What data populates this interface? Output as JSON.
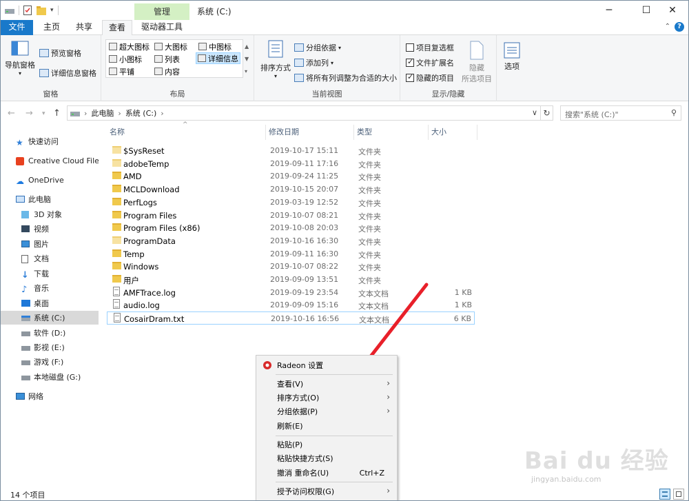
{
  "title": {
    "context_tab": "管理",
    "window_title": "系统 (C:)"
  },
  "tabs": [
    "文件",
    "主页",
    "共享",
    "查看",
    "驱动器工具"
  ],
  "ribbon": {
    "panes": {
      "nav_pane": "导航窗格",
      "preview_pane": "预览窗格",
      "details_pane": "详细信息窗格",
      "group_label": "窗格"
    },
    "layout": {
      "items": [
        "超大图标",
        "大图标",
        "中图标",
        "小图标",
        "列表",
        "详细信息",
        "平铺",
        "内容"
      ],
      "selected": "详细信息",
      "group_label": "布局"
    },
    "current_view": {
      "sort_by": "排序方式",
      "group_by": "分组依据",
      "add_columns": "添加列",
      "size_all_columns": "将所有列调整为合适的大小",
      "group_label": "当前视图"
    },
    "show_hide": {
      "item_checkboxes": {
        "label": "项目复选框",
        "checked": false
      },
      "file_extensions": {
        "label": "文件扩展名",
        "checked": true
      },
      "hidden_items": {
        "label": "隐藏的项目",
        "checked": true
      },
      "hide_selected": "隐藏\n所选项目",
      "hide_line1": "隐藏",
      "hide_line2": "所选项目",
      "options": "选项",
      "group_label": "显示/隐藏"
    }
  },
  "address": {
    "crumbs": [
      "此电脑",
      "系统 (C:)"
    ],
    "search_placeholder": "搜索\"系统 (C:)\""
  },
  "nav_pane": [
    {
      "label": "快速访问",
      "icon": "star-icon"
    },
    {
      "label": "Creative Cloud Files",
      "icon": "creative-cloud-icon"
    },
    {
      "label": "OneDrive",
      "icon": "cloud-icon"
    },
    {
      "label": "此电脑",
      "icon": "computer-icon"
    },
    {
      "label": "3D 对象",
      "icon": "cube-icon"
    },
    {
      "label": "视频",
      "icon": "video-icon"
    },
    {
      "label": "图片",
      "icon": "picture-icon"
    },
    {
      "label": "文档",
      "icon": "document-icon"
    },
    {
      "label": "下载",
      "icon": "download-icon"
    },
    {
      "label": "音乐",
      "icon": "music-icon"
    },
    {
      "label": "桌面",
      "icon": "desktop-icon"
    },
    {
      "label": "系统 (C:)",
      "icon": "system-drive-icon",
      "selected": true
    },
    {
      "label": "软件 (D:)",
      "icon": "drive-icon"
    },
    {
      "label": "影视 (E:)",
      "icon": "drive-icon"
    },
    {
      "label": "游戏 (F:)",
      "icon": "drive-icon"
    },
    {
      "label": "本地磁盘 (G:)",
      "icon": "drive-icon"
    },
    {
      "label": "网络",
      "icon": "network-icon"
    }
  ],
  "columns": [
    "名称",
    "修改日期",
    "类型",
    "大小"
  ],
  "files": [
    {
      "name": "$SysReset",
      "date": "2019-10-17 15:11",
      "type": "文件夹",
      "size": "",
      "kind": "folder-light"
    },
    {
      "name": "adobeTemp",
      "date": "2019-09-11 17:16",
      "type": "文件夹",
      "size": "",
      "kind": "folder-light"
    },
    {
      "name": "AMD",
      "date": "2019-09-24 11:25",
      "type": "文件夹",
      "size": "",
      "kind": "folder"
    },
    {
      "name": "MCLDownload",
      "date": "2019-10-15 20:07",
      "type": "文件夹",
      "size": "",
      "kind": "folder"
    },
    {
      "name": "PerfLogs",
      "date": "2019-03-19 12:52",
      "type": "文件夹",
      "size": "",
      "kind": "folder"
    },
    {
      "name": "Program Files",
      "date": "2019-10-07 08:21",
      "type": "文件夹",
      "size": "",
      "kind": "folder"
    },
    {
      "name": "Program Files (x86)",
      "date": "2019-10-08 20:03",
      "type": "文件夹",
      "size": "",
      "kind": "folder"
    },
    {
      "name": "ProgramData",
      "date": "2019-10-16 16:30",
      "type": "文件夹",
      "size": "",
      "kind": "folder-light"
    },
    {
      "name": "Temp",
      "date": "2019-09-11 16:30",
      "type": "文件夹",
      "size": "",
      "kind": "folder"
    },
    {
      "name": "Windows",
      "date": "2019-10-07 08:22",
      "type": "文件夹",
      "size": "",
      "kind": "folder"
    },
    {
      "name": "用户",
      "date": "2019-09-09 13:51",
      "type": "文件夹",
      "size": "",
      "kind": "folder"
    },
    {
      "name": "AMFTrace.log",
      "date": "2019-09-19 23:54",
      "type": "文本文档",
      "size": "1 KB",
      "kind": "doc"
    },
    {
      "name": "audio.log",
      "date": "2019-09-09 15:16",
      "type": "文本文档",
      "size": "1 KB",
      "kind": "doc"
    },
    {
      "name": "CosairDram.txt",
      "date": "2019-10-16 16:56",
      "type": "文本文档",
      "size": "6 KB",
      "kind": "doc",
      "selected": true
    }
  ],
  "context_menu": {
    "radeon": "Radeon 设置",
    "view": "查看(V)",
    "sort_by": "排序方式(O)",
    "group_by": "分组依据(P)",
    "refresh": "刷新(E)",
    "paste": "粘贴(P)",
    "paste_shortcut": "粘贴快捷方式(S)",
    "undo_rename": "撤消 重命名(U)",
    "undo_shortcut": "Ctrl+Z",
    "grant_access": "授予访问权限(G)"
  },
  "status": {
    "item_count": "14 个项目"
  },
  "watermark": {
    "brand": "Bai du 经验",
    "url": "jingyan.baidu.com"
  },
  "colors": {
    "file_tab": "#1979ca",
    "context_tab": "#d4f0c4",
    "selection": "#cce8ff",
    "annotation_arrow": "#e8202a"
  }
}
